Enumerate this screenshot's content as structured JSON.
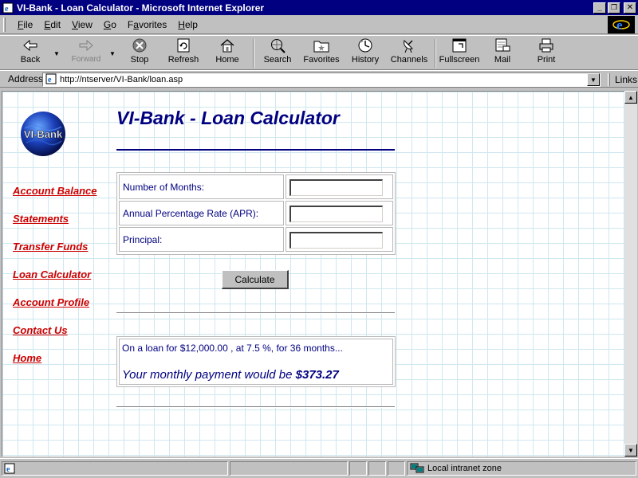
{
  "window": {
    "title": "VI-Bank - Loan Calculator - Microsoft Internet Explorer",
    "controls": [
      "minimize",
      "restore",
      "close"
    ]
  },
  "menu": {
    "items": [
      {
        "label": "File",
        "key": "F",
        "rest": "ile"
      },
      {
        "label": "Edit",
        "key": "E",
        "rest": "dit"
      },
      {
        "label": "View",
        "key": "V",
        "rest": "iew"
      },
      {
        "label": "Go",
        "key": "G",
        "rest": "o"
      },
      {
        "label": "Favorites",
        "key": "a",
        "pre": "F",
        "rest": "vorites"
      },
      {
        "label": "Help",
        "key": "H",
        "rest": "elp"
      }
    ]
  },
  "toolbar": {
    "back": "Back",
    "forward": "Forward",
    "stop": "Stop",
    "refresh": "Refresh",
    "home": "Home",
    "search": "Search",
    "favorites": "Favorites",
    "history": "History",
    "channels": "Channels",
    "fullscreen": "Fullscreen",
    "mail": "Mail",
    "print": "Print"
  },
  "address": {
    "label": "Address",
    "url": "http://ntserver/VI-Bank/loan.asp",
    "links_label": "Links"
  },
  "page": {
    "logo_text": "VI-Bank",
    "title": "VI-Bank - Loan Calculator",
    "nav": [
      "Account Balance",
      "Statements",
      "Transfer Funds",
      "Loan Calculator",
      "Account Profile",
      "Contact Us",
      "Home"
    ],
    "form": {
      "months_label": "Number of Months:",
      "months_value": "",
      "apr_label": "Annual Percentage Rate (APR):",
      "apr_value": "",
      "principal_label": "Principal:",
      "principal_value": "",
      "calculate_label": "Calculate"
    },
    "result": {
      "summary": "On a loan for $12,000.00 , at 7.5 %, for 36 months...",
      "payment_prefix": "Your monthly payment would be",
      "payment_amount": "$373.27"
    }
  },
  "status": {
    "zone": "Local intranet zone"
  },
  "colors": {
    "title_bar": "#000080",
    "heading": "#000080",
    "nav_link": "#cc0000",
    "grid": "#cfe7f0"
  }
}
